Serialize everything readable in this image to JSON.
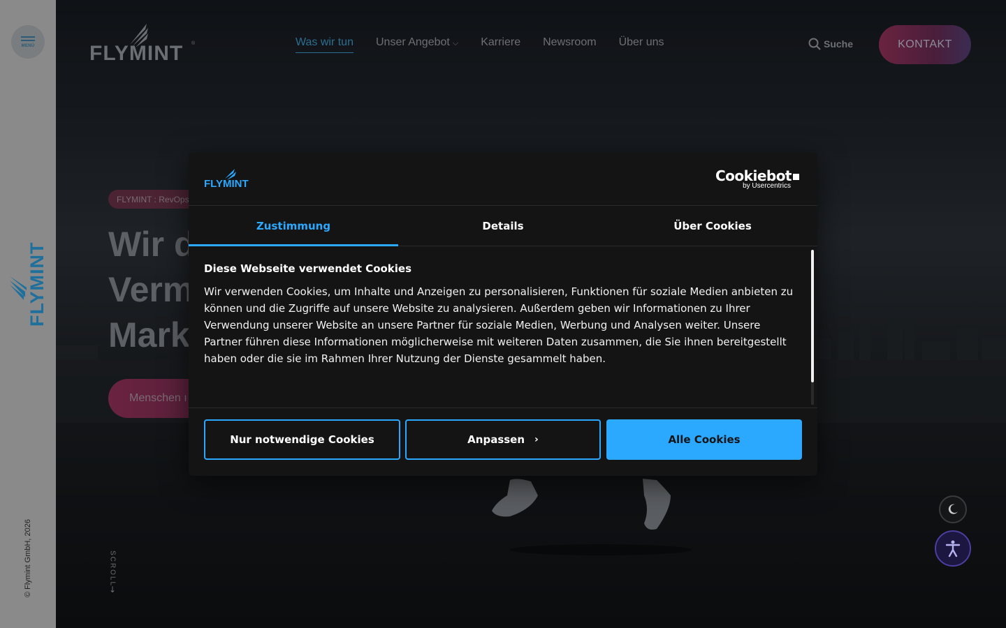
{
  "rail": {
    "menu_label": "MENÜ",
    "copyright": "© Flymint GmbH, 2026"
  },
  "header": {
    "nav": [
      {
        "label": "Was wir tun",
        "active": true
      },
      {
        "label": "Unser Angebot",
        "active": false,
        "dropdown": true
      },
      {
        "label": "Karriere",
        "active": false
      },
      {
        "label": "Newsroom",
        "active": false
      },
      {
        "label": "Über uns",
        "active": false
      }
    ],
    "search_label": "Suche",
    "contact_label": "KONTAKT"
  },
  "hero": {
    "tag": "FLYMINT : RevOps",
    "headline_lines": [
      "Wir d",
      "Verm",
      "Mark"
    ],
    "cta_label": "Menschen ı",
    "scroll_label": "SCROLL"
  },
  "cookie_dialog": {
    "provider": "Cookiebot",
    "provider_by": "by Usercentrics",
    "tabs": [
      {
        "label": "Zustimmung",
        "active": true
      },
      {
        "label": "Details",
        "active": false
      },
      {
        "label": "Über Cookies",
        "active": false
      }
    ],
    "heading": "Diese Webseite verwendet Cookies",
    "body": "Wir verwenden Cookies, um Inhalte und Anzeigen zu personalisieren, Funktionen für soziale Medien anbieten zu können und die Zugriffe auf unsere Website zu analysieren. Außerdem geben wir Informationen zu Ihrer Verwendung unserer Website an unsere Partner für soziale Medien, Werbung und Analysen weiter. Unsere Partner führen diese Informationen möglicherweise mit weiteren Daten zusammen, die Sie ihnen bereitgestellt haben oder die sie im Rahmen Ihrer Nutzung der Dienste gesammelt haben.",
    "buttons": {
      "necessary": "Nur notwendige Cookies",
      "customize": "Anpassen",
      "all": "Alle Cookies"
    }
  },
  "colors": {
    "accent": "#2ba8ff",
    "brand_blue": "#1f6f9c",
    "dialog_bg": "#141414",
    "contact_gradient": "#6a2340"
  },
  "icons": [
    "menu-icon",
    "search-icon",
    "chevron-down-icon",
    "moon-icon",
    "accessibility-icon",
    "arrow-down-icon",
    "chevron-right-icon"
  ]
}
